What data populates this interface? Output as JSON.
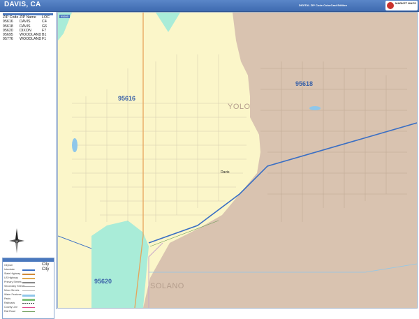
{
  "header": {
    "title": "DAVIS, CA",
    "edition": "DIGITAL ZIP Code ColorCast Edition",
    "logo_text": "MARKET MAPS"
  },
  "zip_table": {
    "columns": [
      "ZIP Code",
      "ZIP Name",
      "LOC"
    ],
    "rows": [
      [
        "95616",
        "DAVIS",
        "C4"
      ],
      [
        "95618",
        "DAVIS",
        "G6"
      ],
      [
        "95620",
        "DIXON",
        "F7"
      ],
      [
        "95695",
        "WOODLAND",
        "B1"
      ],
      [
        "95776",
        "WOODLAND",
        "F1"
      ]
    ]
  },
  "legend": {
    "items": [
      "Cityhall",
      "Interstate",
      "State Highway",
      "US Highway",
      "Primary Streets",
      "Secondary Streets",
      "Minor Streets",
      "Water Features",
      "Parks",
      "Railroads",
      "County Line",
      "Rail Road"
    ],
    "city_labels": [
      "City",
      "City"
    ],
    "colors": {
      "interstate": "#3a6fc4",
      "highway": "#d08a3a",
      "secondary": "#6aa3d8",
      "park": "#7fc27a",
      "water": "#8fc7ea"
    }
  },
  "map": {
    "zips": [
      {
        "code": "95616",
        "color": "#fbf6c9"
      },
      {
        "code": "95618",
        "color": "#d9c3b0"
      },
      {
        "code": "95620",
        "color": "#a9ecd8"
      },
      {
        "code": "95695",
        "color": "#a9ecd8"
      }
    ],
    "counties": [
      "YOLO",
      "SOLANO"
    ],
    "cities": [
      "Davis"
    ],
    "small_badge": "95695"
  }
}
